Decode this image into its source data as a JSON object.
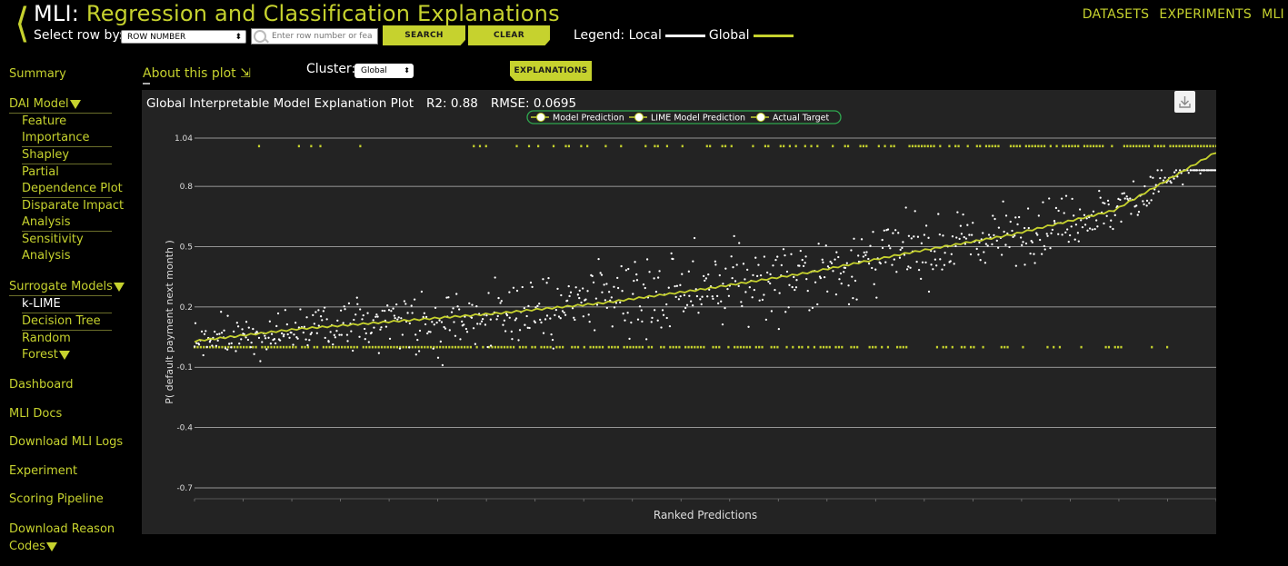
{
  "header": {
    "title_prefix": "MLI:",
    "title_main": "Regression and Classification Explanations",
    "select_label": "Select row by:",
    "select_value": "ROW NUMBER",
    "search_placeholder": "Enter row number or fea",
    "search_button": "SEARCH",
    "clear_button": "CLEAR",
    "legend_label": "Legend: Local",
    "legend_global": "Global",
    "nav": [
      "DATASETS",
      "EXPERIMENTS",
      "MLI"
    ]
  },
  "sidebar": {
    "summary": "Summary",
    "dai_model": "DAI Model",
    "dai_items": [
      "Feature",
      "Importance",
      "Shapley",
      "Partial",
      "Dependence Plot",
      "Disparate Impact",
      "Analysis",
      "Sensitivity",
      "Analysis"
    ],
    "surrogate": "Surrogate Models",
    "surrogate_items": [
      "k-LIME",
      "Decision Tree",
      "Random",
      "Forest"
    ],
    "dashboard": "Dashboard",
    "mli_docs": "MLI Docs",
    "download_logs": "Download MLI Logs",
    "experiment": "Experiment",
    "scoring": "Scoring Pipeline",
    "download_reason": "Download Reason",
    "codes": "Codes"
  },
  "controls": {
    "about": "About this plot",
    "cluster_label": "Cluster:",
    "cluster_value": "Global",
    "explanations_button": "EXPLANATIONS"
  },
  "chart_data": {
    "type": "scatter",
    "title": "Global Interpretable Model Explanation Plot",
    "r2": "R2: 0.88",
    "rmse": "RMSE: 0.0695",
    "xlabel": "Ranked Predictions",
    "ylabel": "P( default payment next month )",
    "ylim": [
      -0.7,
      1.04
    ],
    "yticks": [
      "1.04",
      "0.8",
      "0.5",
      "0.2",
      "-0.1",
      "-0.4",
      "-0.7"
    ],
    "legend": [
      "Model Prediction",
      "LIME Model Prediction",
      "Actual Target"
    ],
    "legend_position": "top-center",
    "grid": true,
    "colors": {
      "model": "#c6d22e",
      "lime": "#ffffff",
      "target": "#c6d22e",
      "legend_border": "#2fa84f"
    },
    "model_prediction_line": [
      [
        0,
        0.03
      ],
      [
        10,
        0.09
      ],
      [
        20,
        0.13
      ],
      [
        30,
        0.17
      ],
      [
        40,
        0.22
      ],
      [
        50,
        0.29
      ],
      [
        60,
        0.37
      ],
      [
        70,
        0.47
      ],
      [
        80,
        0.56
      ],
      [
        90,
        0.68
      ],
      [
        100,
        0.97
      ]
    ],
    "actual_target": [
      0,
      1
    ],
    "n_points": 1000
  }
}
